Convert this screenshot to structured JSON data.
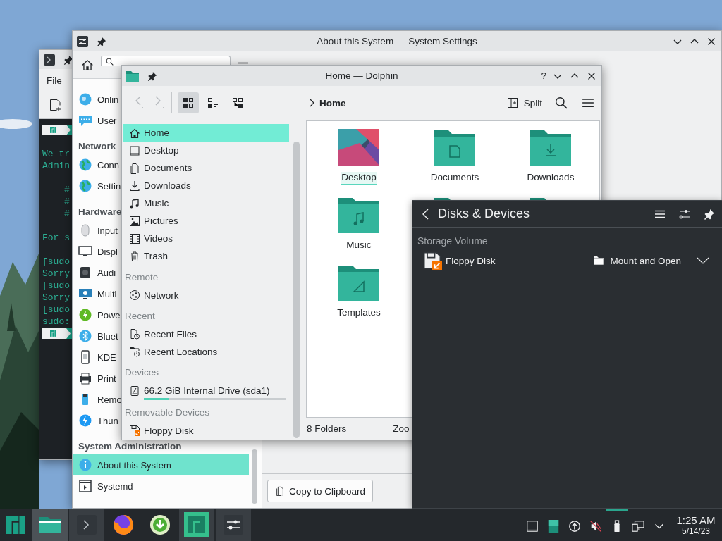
{
  "terminal": {
    "menu": [
      "File"
    ],
    "lines": [
      {
        "kind": "prompt"
      },
      {
        "kind": "blank"
      },
      {
        "kind": "text",
        "text": "We tr"
      },
      {
        "kind": "text",
        "text": "Admin"
      },
      {
        "kind": "blank"
      },
      {
        "kind": "indent",
        "text": "#"
      },
      {
        "kind": "indent",
        "text": "#"
      },
      {
        "kind": "indent",
        "text": "#"
      },
      {
        "kind": "blank"
      },
      {
        "kind": "text",
        "text": "For s"
      },
      {
        "kind": "blank"
      },
      {
        "kind": "text",
        "text": "[sudo"
      },
      {
        "kind": "text",
        "text": "Sorry"
      },
      {
        "kind": "text",
        "text": "[sudo"
      },
      {
        "kind": "text",
        "text": "Sorry"
      },
      {
        "kind": "text",
        "text": "[sudo"
      },
      {
        "kind": "text",
        "text": "sudo:"
      },
      {
        "kind": "prompt"
      }
    ]
  },
  "settings": {
    "title": "About this System — System Settings",
    "copy_button": "Copy to Clipboard",
    "sidebar": [
      {
        "kind": "item",
        "label": "Onlin",
        "selected": false
      },
      {
        "kind": "item",
        "label": "User",
        "selected": false
      },
      {
        "kind": "header",
        "label": "Network"
      },
      {
        "kind": "item",
        "label": "Conn",
        "selected": false
      },
      {
        "kind": "item",
        "label": "Settin",
        "selected": false
      },
      {
        "kind": "header",
        "label": "Hardware"
      },
      {
        "kind": "item",
        "label": "Input",
        "selected": false
      },
      {
        "kind": "item",
        "label": "Displ",
        "selected": false
      },
      {
        "kind": "item",
        "label": "Audi",
        "selected": false
      },
      {
        "kind": "item",
        "label": "Multi",
        "selected": false
      },
      {
        "kind": "item",
        "label": "Powe",
        "selected": false
      },
      {
        "kind": "item",
        "label": "Bluet",
        "selected": false
      },
      {
        "kind": "item",
        "label": "KDE",
        "selected": false
      },
      {
        "kind": "item",
        "label": "Print",
        "selected": false
      },
      {
        "kind": "item",
        "label": "Remo",
        "selected": false
      },
      {
        "kind": "item",
        "label": "Thun",
        "selected": false
      },
      {
        "kind": "header",
        "label": "System Administration"
      },
      {
        "kind": "item",
        "label": "About this System",
        "selected": true
      },
      {
        "kind": "item",
        "label": "Systemd",
        "selected": false
      }
    ]
  },
  "dolphin": {
    "title": "Home — Dolphin",
    "help": "?",
    "nav": [
      {
        "kind": "back",
        "disabled": true
      },
      {
        "kind": "forward",
        "disabled": true
      }
    ],
    "views": [
      {
        "kind": "icons",
        "selected": true
      },
      {
        "kind": "details",
        "selected": false
      },
      {
        "kind": "tree",
        "selected": false
      }
    ],
    "breadcrumb": "Home",
    "split": "Split",
    "places": [
      {
        "kind": "place",
        "label": "Home",
        "selected": true
      },
      {
        "kind": "place",
        "label": "Desktop",
        "selected": false
      },
      {
        "kind": "place",
        "label": "Documents",
        "selected": false
      },
      {
        "kind": "place",
        "label": "Downloads",
        "selected": false
      },
      {
        "kind": "place",
        "label": "Music",
        "selected": false
      },
      {
        "kind": "place",
        "label": "Pictures",
        "selected": false
      },
      {
        "kind": "place",
        "label": "Videos",
        "selected": false
      },
      {
        "kind": "place",
        "label": "Trash",
        "selected": false
      },
      {
        "kind": "header",
        "label": "Remote"
      },
      {
        "kind": "place",
        "label": "Network",
        "selected": false
      },
      {
        "kind": "header",
        "label": "Recent"
      },
      {
        "kind": "place",
        "label": "Recent Files",
        "selected": false
      },
      {
        "kind": "place",
        "label": "Recent Locations",
        "selected": false
      },
      {
        "kind": "header",
        "label": "Devices"
      },
      {
        "kind": "drive",
        "label": "66.2 GiB Internal Drive (sda1)",
        "selected": false,
        "level": 0.18
      },
      {
        "kind": "header",
        "label": "Removable Devices"
      },
      {
        "kind": "place",
        "label": "Floppy Disk",
        "selected": false
      }
    ],
    "items": [
      {
        "kind": "desktop",
        "label": "Desktop",
        "focused": true
      },
      {
        "kind": "documents",
        "label": "Documents",
        "focused": false
      },
      {
        "kind": "downloads",
        "label": "Downloads",
        "focused": false
      },
      {
        "kind": "music",
        "label": "Music",
        "focused": false
      },
      {
        "kind": "folder"
      },
      {
        "kind": "folder"
      },
      {
        "kind": "templates",
        "label": "Templates",
        "focused": false
      }
    ],
    "status": "8 Folders",
    "zoom_label": "Zoo"
  },
  "disks": {
    "title": "Disks & Devices",
    "section": "Storage Volume",
    "devices": [
      {
        "name": "Floppy Disk",
        "action": "Mount and Open"
      }
    ]
  },
  "taskbar": {
    "tasks": [
      {
        "kind": "menu",
        "active": false
      },
      {
        "kind": "task",
        "active": true
      },
      {
        "kind": "task",
        "active": false
      },
      {
        "kind": "launcher",
        "active": false
      },
      {
        "kind": "launcher",
        "active": false
      },
      {
        "kind": "task",
        "active": false
      },
      {
        "kind": "task",
        "active": false
      }
    ],
    "tray": [
      {
        "active": false
      },
      {
        "active": false
      },
      {
        "active": false
      },
      {
        "active": false
      },
      {
        "active": true
      },
      {
        "active": false
      },
      {
        "active": false
      }
    ],
    "time": "1:25 AM",
    "date": "5/14/23"
  }
}
